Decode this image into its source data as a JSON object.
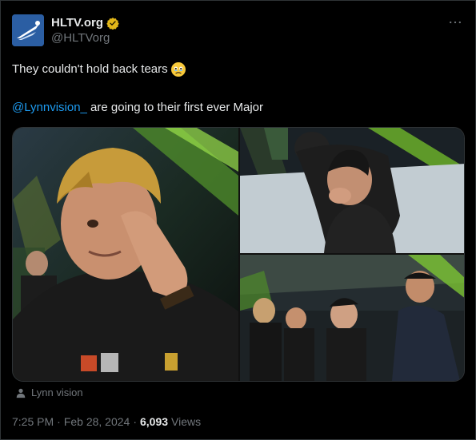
{
  "author": {
    "display_name": "HLTV.org",
    "handle": "@HLTVorg",
    "verified_icon": "gold-verified-badge-icon",
    "avatar_icon": "hltv-logo-icon"
  },
  "more_icon": "more-options-icon",
  "tweet": {
    "line1": "They couldn't hold back tears",
    "emoji": "holding-back-tears-emoji",
    "mention": "@Lynnvision_",
    "line2_rest": " are going to their first ever Major"
  },
  "media": {
    "photos": [
      {
        "name": "photo-player-crying"
      },
      {
        "name": "photo-player-bowing"
      },
      {
        "name": "photo-team-on-stage"
      }
    ]
  },
  "tagged": {
    "icon": "person-icon",
    "label": "Lynn vision"
  },
  "meta": {
    "time": "7:25 PM",
    "separator1": "·",
    "date": "Feb 28, 2024",
    "separator2": "·",
    "views_count": "6,093",
    "views_label": "Views"
  },
  "colors": {
    "background": "#000000",
    "text": "#e7e9ea",
    "secondary": "#71767b",
    "link": "#1d9bf0",
    "verified_gold": "#e2b719",
    "border": "#2f3336"
  }
}
